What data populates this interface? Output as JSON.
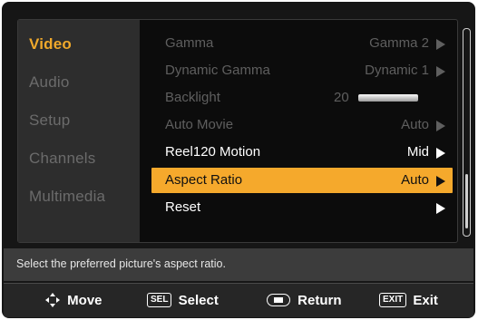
{
  "sidebar": {
    "items": [
      {
        "label": "Video",
        "active": true
      },
      {
        "label": "Audio",
        "active": false
      },
      {
        "label": "Setup",
        "active": false
      },
      {
        "label": "Channels",
        "active": false
      },
      {
        "label": "Multimedia",
        "active": false
      }
    ]
  },
  "menu": {
    "rows": [
      {
        "label": "Gamma",
        "value": "Gamma 2",
        "state": "disabled"
      },
      {
        "label": "Dynamic Gamma",
        "value": "Dynamic 1",
        "state": "disabled"
      },
      {
        "label": "Backlight",
        "value": "20",
        "state": "disabled",
        "slider_level": 0.2
      },
      {
        "label": "Auto Movie",
        "value": "Auto",
        "state": "disabled"
      },
      {
        "label": "Reel120 Motion",
        "value": "Mid",
        "state": "enabled"
      },
      {
        "label": "Aspect Ratio",
        "value": "Auto",
        "state": "selected"
      },
      {
        "label": "Reset",
        "value": "",
        "state": "enabled"
      }
    ]
  },
  "help": {
    "text": "Select the preferred picture's aspect ratio."
  },
  "footer": {
    "move_label": "Move",
    "sel_key": "SEL",
    "select_label": "Select",
    "return_label": "Return",
    "exit_key": "EXIT",
    "exit_label": "Exit"
  },
  "colors": {
    "accent": "#f5a92c",
    "active_text": "#f0a92b",
    "disabled_text": "#5f5f5f"
  },
  "icons": [
    "move-icon",
    "return-icon",
    "arrow-right-icon"
  ]
}
